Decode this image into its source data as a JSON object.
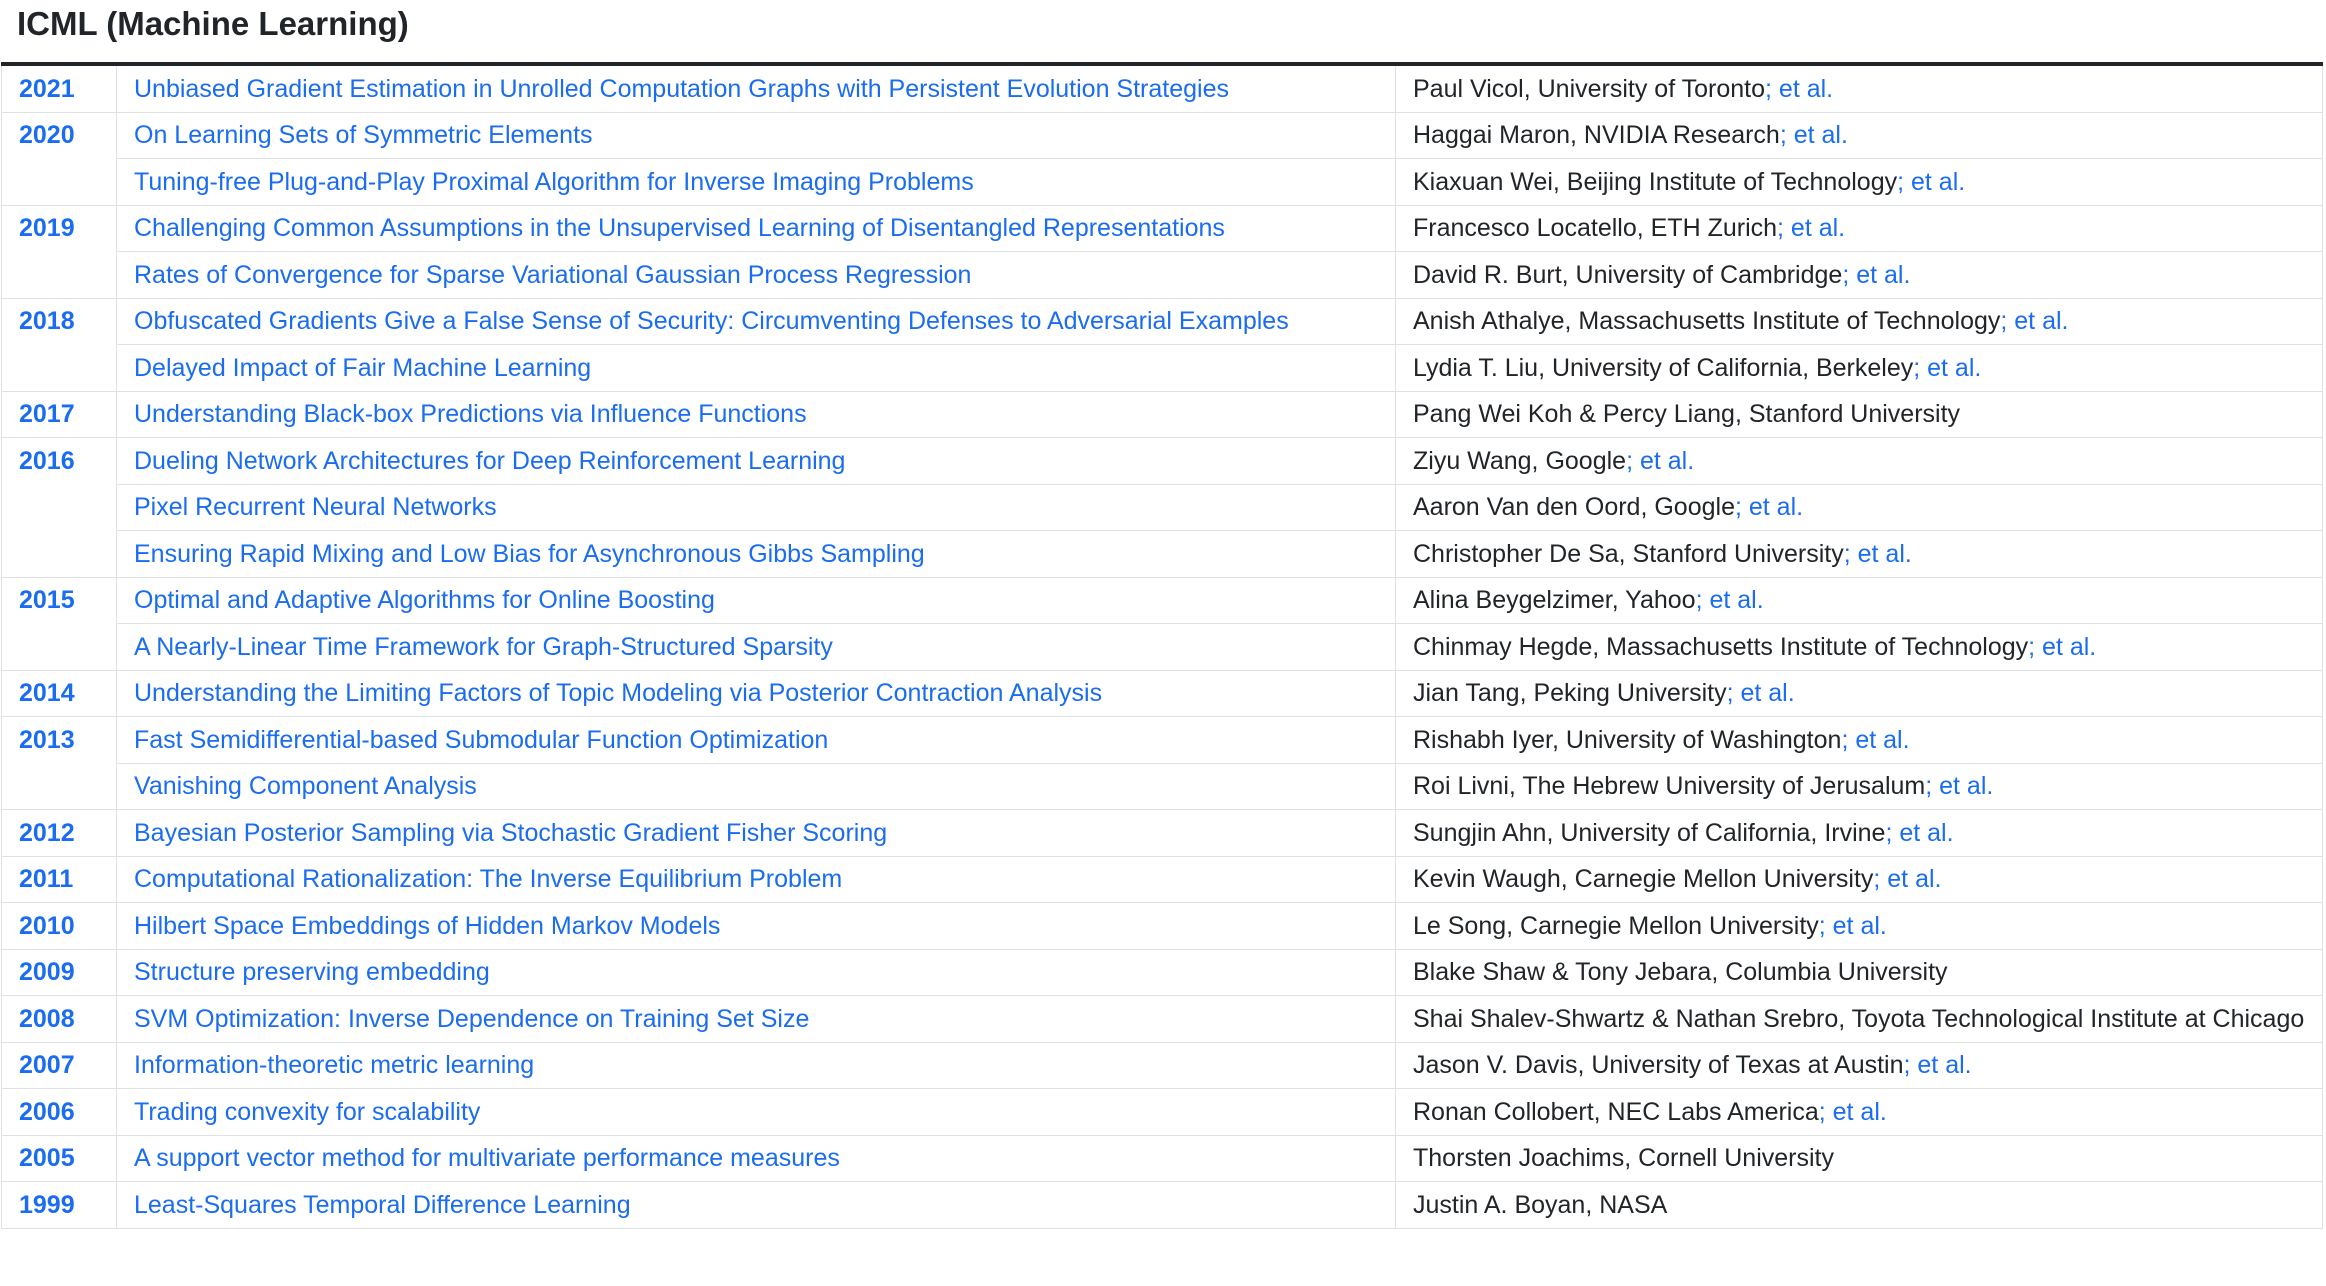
{
  "heading": "ICML (Machine Learning)",
  "link_color": "#1a6cf0",
  "groups": [
    {
      "year": "2021",
      "papers": [
        {
          "title": "Unbiased Gradient Estimation in Unrolled Computation Graphs with Persistent Evolution Strategies",
          "authors": "Paul Vicol, University of Toronto",
          "et_al": "; et al."
        }
      ]
    },
    {
      "year": "2020",
      "papers": [
        {
          "title": "On Learning Sets of Symmetric Elements",
          "authors": "Haggai Maron, NVIDIA Research",
          "et_al": "; et al."
        },
        {
          "title": "Tuning-free Plug-and-Play Proximal Algorithm for Inverse Imaging Problems",
          "authors": "Kiaxuan Wei, Beijing Institute of Technology",
          "et_al": "; et al."
        }
      ]
    },
    {
      "year": "2019",
      "papers": [
        {
          "title": "Challenging Common Assumptions in the Unsupervised Learning of Disentangled Representations",
          "authors": "Francesco Locatello, ETH Zurich",
          "et_al": "; et al."
        },
        {
          "title": "Rates of Convergence for Sparse Variational Gaussian Process Regression",
          "authors": "David R. Burt, University of Cambridge",
          "et_al": "; et al."
        }
      ]
    },
    {
      "year": "2018",
      "papers": [
        {
          "title": "Obfuscated Gradients Give a False Sense of Security: Circumventing Defenses to Adversarial Examples",
          "authors": "Anish Athalye, Massachusetts Institute of Technology",
          "et_al": "; et al."
        },
        {
          "title": "Delayed Impact of Fair Machine Learning",
          "authors": "Lydia T. Liu, University of California, Berkeley",
          "et_al": "; et al."
        }
      ]
    },
    {
      "year": "2017",
      "papers": [
        {
          "title": "Understanding Black-box Predictions via Influence Functions",
          "authors": "Pang Wei Koh & Percy Liang, Stanford University",
          "et_al": ""
        }
      ]
    },
    {
      "year": "2016",
      "papers": [
        {
          "title": "Dueling Network Architectures for Deep Reinforcement Learning",
          "authors": "Ziyu Wang, Google",
          "et_al": "; et al."
        },
        {
          "title": "Pixel Recurrent Neural Networks",
          "authors": "Aaron Van den Oord, Google",
          "et_al": "; et al."
        },
        {
          "title": "Ensuring Rapid Mixing and Low Bias for Asynchronous Gibbs Sampling",
          "authors": "Christopher De Sa, Stanford University",
          "et_al": "; et al."
        }
      ]
    },
    {
      "year": "2015",
      "papers": [
        {
          "title": "Optimal and Adaptive Algorithms for Online Boosting",
          "authors": "Alina Beygelzimer, Yahoo",
          "et_al": "; et al."
        },
        {
          "title": "A Nearly-Linear Time Framework for Graph-Structured Sparsity",
          "authors": "Chinmay Hegde, Massachusetts Institute of Technology",
          "et_al": "; et al."
        }
      ]
    },
    {
      "year": "2014",
      "papers": [
        {
          "title": "Understanding the Limiting Factors of Topic Modeling via Posterior Contraction Analysis",
          "authors": "Jian Tang, Peking University",
          "et_al": "; et al."
        }
      ]
    },
    {
      "year": "2013",
      "papers": [
        {
          "title": "Fast Semidifferential-based Submodular Function Optimization",
          "authors": "Rishabh Iyer, University of Washington",
          "et_al": "; et al."
        },
        {
          "title": "Vanishing Component Analysis",
          "authors": "Roi Livni, The Hebrew University of Jerusalum",
          "et_al": "; et al."
        }
      ]
    },
    {
      "year": "2012",
      "papers": [
        {
          "title": "Bayesian Posterior Sampling via Stochastic Gradient Fisher Scoring",
          "authors": "Sungjin Ahn, University of California, Irvine",
          "et_al": "; et al."
        }
      ]
    },
    {
      "year": "2011",
      "papers": [
        {
          "title": "Computational Rationalization: The Inverse Equilibrium Problem",
          "authors": "Kevin Waugh, Carnegie Mellon University",
          "et_al": "; et al."
        }
      ]
    },
    {
      "year": "2010",
      "papers": [
        {
          "title": "Hilbert Space Embeddings of Hidden Markov Models",
          "authors": "Le Song, Carnegie Mellon University",
          "et_al": "; et al."
        }
      ]
    },
    {
      "year": "2009",
      "papers": [
        {
          "title": "Structure preserving embedding",
          "authors": "Blake Shaw & Tony Jebara, Columbia University",
          "et_al": ""
        }
      ]
    },
    {
      "year": "2008",
      "papers": [
        {
          "title": "SVM Optimization: Inverse Dependence on Training Set Size",
          "authors": "Shai Shalev-Shwartz & Nathan Srebro, Toyota Technological Institute at Chicago",
          "et_al": ""
        }
      ]
    },
    {
      "year": "2007",
      "papers": [
        {
          "title": "Information-theoretic metric learning",
          "authors": "Jason V. Davis, University of Texas at Austin",
          "et_al": "; et al."
        }
      ]
    },
    {
      "year": "2006",
      "papers": [
        {
          "title": "Trading convexity for scalability",
          "authors": "Ronan Collobert, NEC Labs America",
          "et_al": "; et al."
        }
      ]
    },
    {
      "year": "2005",
      "papers": [
        {
          "title": "A support vector method for multivariate performance measures",
          "authors": "Thorsten Joachims, Cornell University",
          "et_al": ""
        }
      ]
    },
    {
      "year": "1999",
      "papers": [
        {
          "title": "Least-Squares Temporal Difference Learning",
          "authors": "Justin A. Boyan, NASA",
          "et_al": ""
        }
      ]
    }
  ]
}
